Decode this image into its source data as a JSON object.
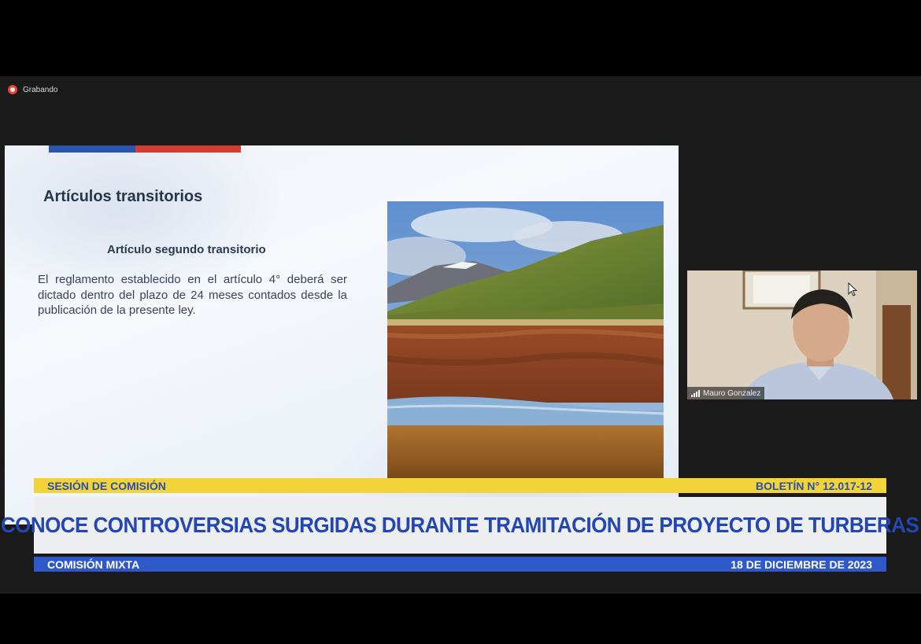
{
  "recording": {
    "label": "Grabando"
  },
  "slide": {
    "title": "Artículos transitorios",
    "subtitle": "Artículo segundo transitorio",
    "body": "El reglamento establecido en el artículo 4° deberá ser dictado dentro del plazo de 24 meses contados desde la publicación de la presente ley.",
    "photo_icon": "landscape-peatland-photo"
  },
  "webcam": {
    "participant_name": "Mauro Gonzalez",
    "signal_icon": "signal-bars-icon"
  },
  "lower_third": {
    "top_left": "SESIÓN DE COMISIÓN",
    "top_right": "BOLETÍN N° 12.017-12",
    "headline": "CONOCE CONTROVERSIAS SURGIDAS DURANTE TRAMITACIÓN DE PROYECTO DE TURBERAS",
    "bottom_left": "COMISIÓN MIXTA",
    "bottom_right": "18 DE DICIEMBRE DE 2023"
  },
  "colors": {
    "headline_blue": "#2446b0",
    "top_bar_yellow": "#f2d33a",
    "bottom_bar_blue": "#2f58c8",
    "flag_blue": "#2a55b0",
    "flag_red": "#d63c32",
    "recording_red": "#e0453a"
  }
}
